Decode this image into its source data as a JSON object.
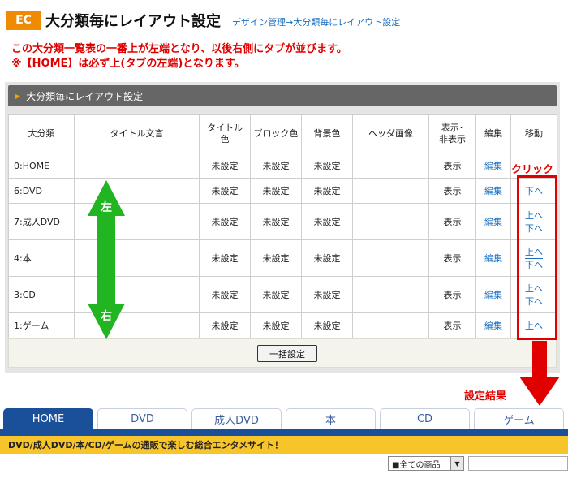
{
  "header": {
    "badge": "EC",
    "title": "大分類毎にレイアウト設定",
    "breadcrumb": "デザイン管理→大分類毎にレイアウト設定"
  },
  "notice": {
    "line1": "この大分類一覧表の一番上が左端となり、以後右側にタブが並びます。",
    "line2": "※【HOME】は必ず上(タブの左端)となります。"
  },
  "panel": {
    "title": "大分類毎にレイアウト設定",
    "columns": {
      "category": "大分類",
      "title_text": "タイトル文言",
      "title_color_1": "タイトル",
      "title_color_2": "色",
      "block_color": "ブロック色",
      "bg_color": "背景色",
      "header_image": "ヘッダ画像",
      "display_1": "表示･",
      "display_2": "非表示",
      "edit": "編集",
      "move": "移動"
    },
    "rows": [
      {
        "category": "0:HOME",
        "title_color": "未設定",
        "block_color": "未設定",
        "bg_color": "未設定",
        "display": "表示",
        "edit": "編集",
        "move_up": "",
        "move_down": ""
      },
      {
        "category": "6:DVD",
        "title_color": "未設定",
        "block_color": "未設定",
        "bg_color": "未設定",
        "display": "表示",
        "edit": "編集",
        "move_up": "",
        "move_down": "下へ"
      },
      {
        "category": "7:成人DVD",
        "title_color": "未設定",
        "block_color": "未設定",
        "bg_color": "未設定",
        "display": "表示",
        "edit": "編集",
        "move_up": "上へ",
        "move_down": "下へ"
      },
      {
        "category": "4:本",
        "title_color": "未設定",
        "block_color": "未設定",
        "bg_color": "未設定",
        "display": "表示",
        "edit": "編集",
        "move_up": "上へ",
        "move_down": "下へ"
      },
      {
        "category": "3:CD",
        "title_color": "未設定",
        "block_color": "未設定",
        "bg_color": "未設定",
        "display": "表示",
        "edit": "編集",
        "move_up": "上へ",
        "move_down": "下へ"
      },
      {
        "category": "1:ゲーム",
        "title_color": "未設定",
        "block_color": "未設定",
        "bg_color": "未設定",
        "display": "表示",
        "edit": "編集",
        "move_up": "上へ",
        "move_down": ""
      }
    ],
    "bulk_button": "一括設定"
  },
  "annotations": {
    "left": "左",
    "right": "右",
    "click": "クリック",
    "result": "設定結果"
  },
  "tabs": [
    "HOME",
    "DVD",
    "成人DVD",
    "本",
    "CD",
    "ゲーム"
  ],
  "active_tab": "HOME",
  "tagline": "DVD/成人DVD/本/CD/ゲームの通販で楽しむ総合エンタメサイト！",
  "search": {
    "select_value": "■全ての商品"
  },
  "colors": {
    "accent_orange": "#f08a00",
    "notice_red": "#e00000",
    "link_blue": "#1a6fc0",
    "tab_blue": "#1a4f9a",
    "tagline_yellow": "#f7c42a",
    "arrow_green": "#22b522"
  }
}
